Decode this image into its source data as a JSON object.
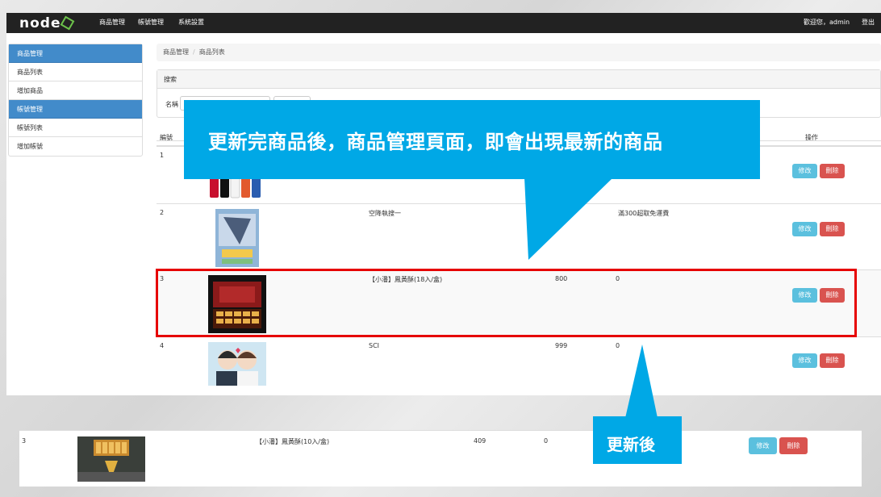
{
  "navbar": {
    "logo_text": "node",
    "menu": [
      "商品管理",
      "帳號管理",
      "系統設置"
    ],
    "welcome": "歡迎您，admin",
    "logout": "登出"
  },
  "sidebar": {
    "items": [
      {
        "label": "商品管理",
        "header": true
      },
      {
        "label": "商品列表",
        "header": false
      },
      {
        "label": "增加商品",
        "header": false
      },
      {
        "label": "帳號管理",
        "header": true
      },
      {
        "label": "帳號列表",
        "header": false
      },
      {
        "label": "增加帳號",
        "header": false
      }
    ]
  },
  "breadcrumb": {
    "root": "商品管理",
    "current": "商品列表"
  },
  "search": {
    "title": "搜索",
    "name_label": "名稱"
  },
  "table": {
    "headers": {
      "id": "編號",
      "actions": "操作"
    },
    "edit_label": "修改",
    "delete_label": "刪除",
    "rows": [
      {
        "id": "1",
        "name": "",
        "price": "",
        "qty": "",
        "desc": ""
      },
      {
        "id": "2",
        "name": "空降執搜一",
        "price": "",
        "qty": "",
        "desc": "滿300超取免運費"
      },
      {
        "id": "3",
        "name": "【小潘】鳳黃酥(18入/盒)",
        "price": "800",
        "qty": "0",
        "desc": ""
      },
      {
        "id": "4",
        "name": "SCI",
        "price": "999",
        "qty": "0",
        "desc": ""
      }
    ]
  },
  "updated_row": {
    "id": "3",
    "name": "【小潘】鳳黃酥(10入/盒)",
    "price": "409",
    "qty": "0"
  },
  "callouts": {
    "main": "更新完商品後，商品管理頁面，即會出現最新的商品",
    "updated": "更新後"
  },
  "colors": {
    "navbar": "#222222",
    "accent": "#428bca",
    "callout": "#00a8e6",
    "edit": "#5bc0de",
    "delete": "#d9534f",
    "highlight": "#e60000"
  }
}
